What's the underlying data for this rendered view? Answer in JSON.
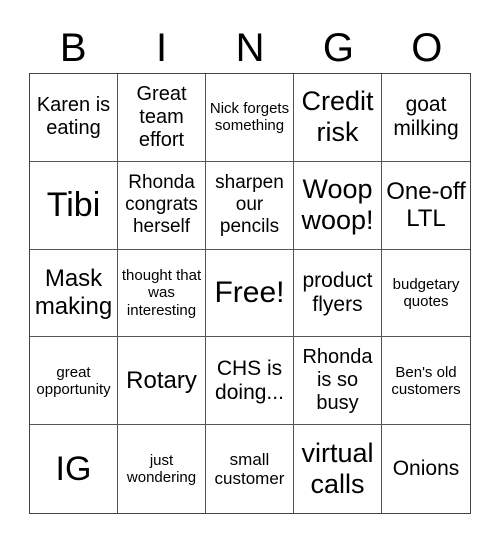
{
  "header": [
    "B",
    "I",
    "N",
    "G",
    "O"
  ],
  "cells": [
    "Karen is eating",
    "Great team effort",
    "Nick forgets something",
    "Credit risk",
    "goat milking",
    "Tibi",
    "Rhonda congrats herself",
    "sharpen our pencils",
    "Woop woop!",
    "One-off LTL",
    "Mask making",
    "thought that was interesting",
    "Free!",
    "product flyers",
    "budgetary quotes",
    "great opportunity",
    "Rotary",
    "CHS is doing...",
    "Rhonda is so busy",
    "Ben's old customers",
    "IG",
    "just wondering",
    "small customer",
    "virtual calls",
    "Onions"
  ]
}
